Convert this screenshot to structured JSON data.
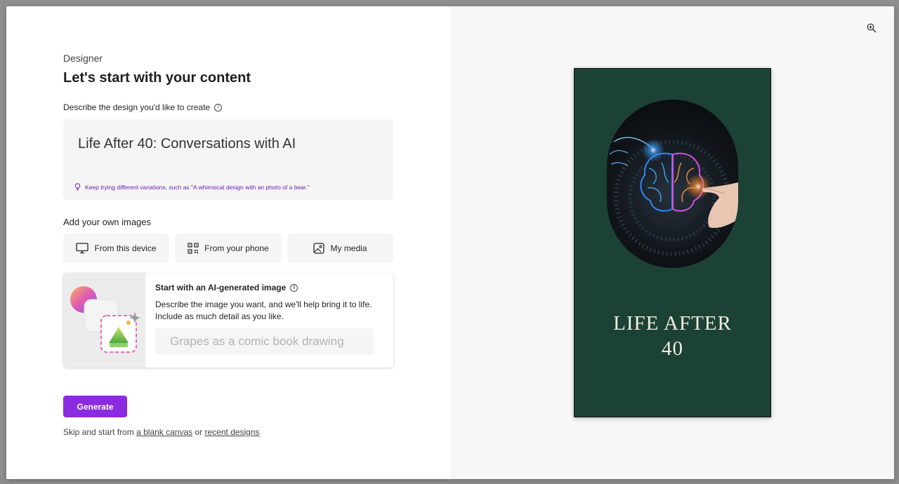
{
  "app": {
    "name": "Designer"
  },
  "heading": {
    "title": "Let's start with your content"
  },
  "describe": {
    "label": "Describe the design you'd like to create",
    "value": "Life After 40: Conversations with AI",
    "hint": "Keep trying different variations, such as \"A whimsical design with an photo of a bear.\""
  },
  "images": {
    "label": "Add your own images",
    "buttons": [
      {
        "label": "From this device",
        "icon": "monitor-icon"
      },
      {
        "label": "From your phone",
        "icon": "qr-code-icon"
      },
      {
        "label": "My media",
        "icon": "image-icon"
      }
    ]
  },
  "ai_card": {
    "title": "Start with an AI-generated image",
    "description": "Describe the image you want, and we'll help bring it to life. Include as much detail as you like.",
    "placeholder": "Grapes as a comic book drawing"
  },
  "actions": {
    "generate_label": "Generate",
    "skip_prefix": "Skip and start from",
    "blank_canvas": "a blank canvas",
    "or_text": "or",
    "recent_designs": "recent designs"
  },
  "preview": {
    "title_line1": "LIFE AFTER",
    "title_line2": "40",
    "background_color": "#1c4236",
    "zoom_icon": "zoom-in-icon"
  },
  "colors": {
    "accent": "#8a2be2",
    "hint": "#6b1fb1"
  }
}
